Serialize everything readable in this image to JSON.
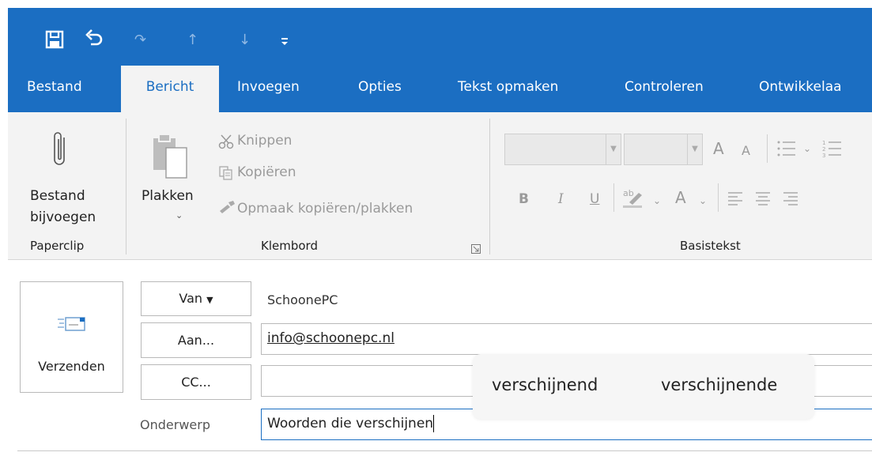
{
  "quick_access": {
    "icons": [
      "save-icon",
      "undo-icon",
      "redo-icon",
      "up-arrow-icon",
      "down-arrow-icon",
      "customize-icon"
    ]
  },
  "tabs": [
    {
      "label": "Bestand"
    },
    {
      "label": "Bericht",
      "active": true
    },
    {
      "label": "Invoegen"
    },
    {
      "label": "Opties"
    },
    {
      "label": "Tekst opmaken"
    },
    {
      "label": "Controleren"
    },
    {
      "label": "Ontwikkelaa"
    }
  ],
  "ribbon": {
    "paperclip": {
      "attach_line1": "Bestand",
      "attach_line2": "bijvoegen",
      "group": "Paperclip"
    },
    "klembord": {
      "paste": "Plakken",
      "cut": "Knippen",
      "copy": "Kopiëren",
      "format_painter": "Opmaak kopiëren/plakken",
      "group": "Klembord"
    },
    "basistekst": {
      "group": "Basistekst",
      "bold": "B",
      "italic": "I",
      "underline": "U",
      "font_grow": "A",
      "font_shrink": "A",
      "font_color": "A"
    }
  },
  "compose": {
    "send_label": "Verzenden",
    "from_button": "Van",
    "from_value": "SchoonePC",
    "to_button": "Aan...",
    "to_value": "info@schoonepc.nl",
    "cc_button": "CC...",
    "cc_value": "",
    "subject_label": "Onderwerp",
    "subject_value": "Woorden die verschijnen"
  },
  "suggestions": [
    "verschijnend",
    "verschijnende"
  ],
  "colors": {
    "accent": "#1b6ec2",
    "ribbon_bg": "#f3f3f3"
  }
}
